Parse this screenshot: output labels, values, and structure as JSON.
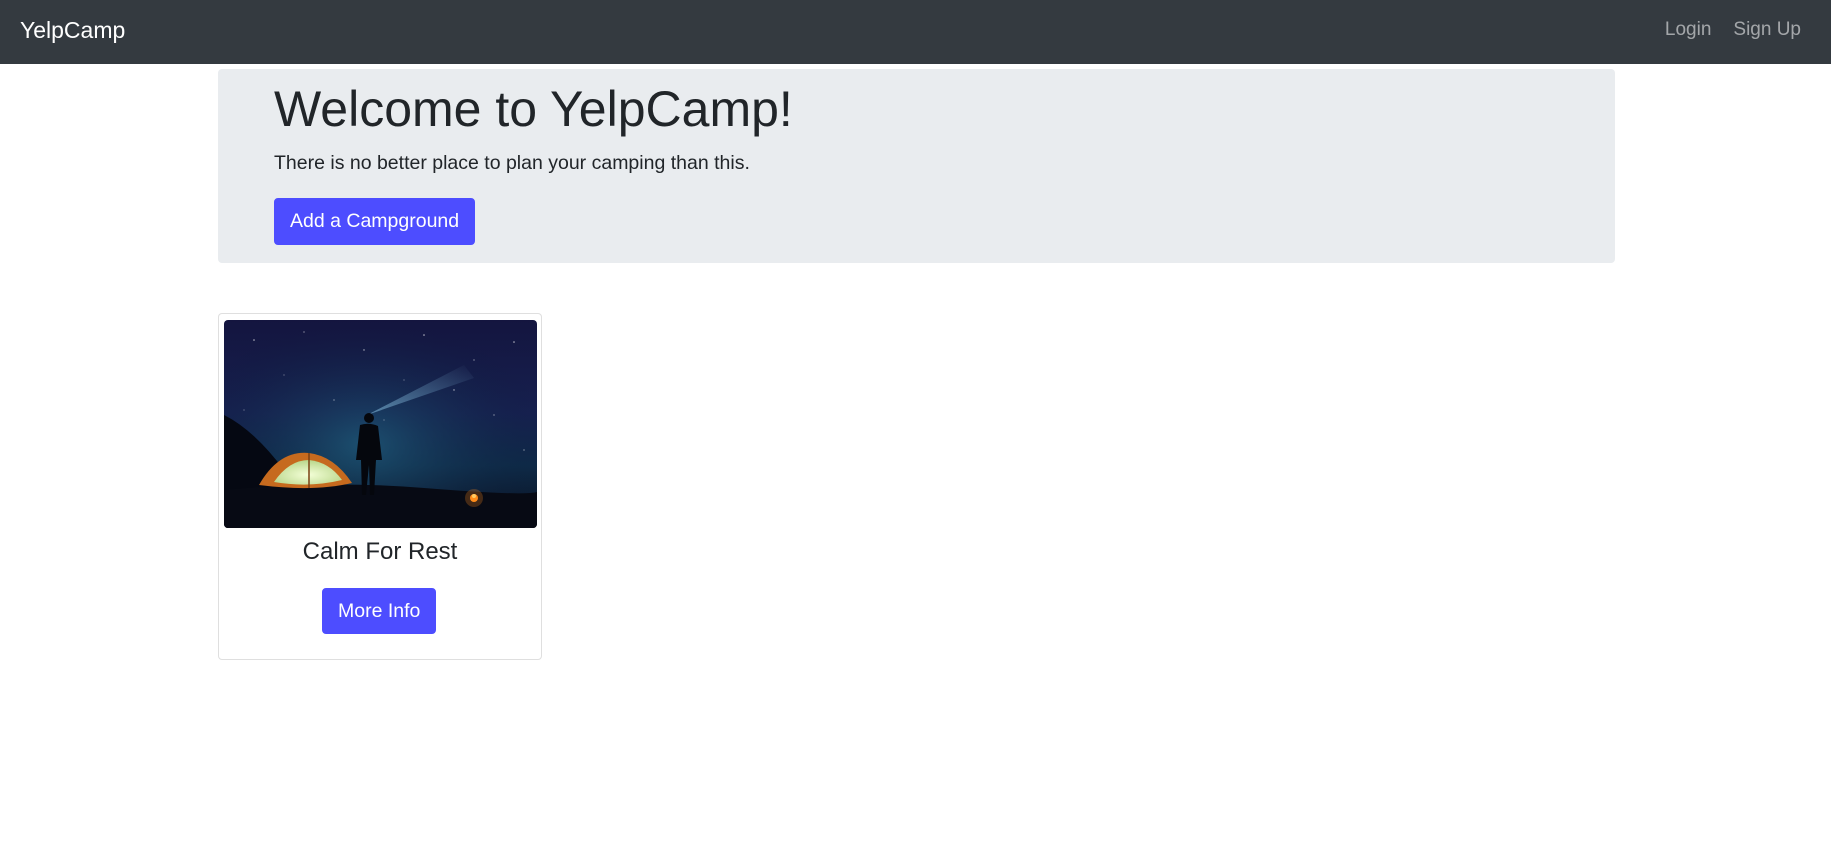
{
  "navbar": {
    "brand": "YelpCamp",
    "links": {
      "login": "Login",
      "signup": "Sign Up"
    }
  },
  "jumbotron": {
    "title": "Welcome to YelpCamp!",
    "lead": "There is no better place to plan your camping than this.",
    "button_label": "Add a Campground"
  },
  "campgrounds": [
    {
      "name": "Calm For Rest",
      "button_label": "More Info",
      "image_icon": "night-camping-photo"
    }
  ],
  "colors": {
    "navbar_bg": "#343a40",
    "jumbotron_bg": "#e9ecef",
    "accent": "#4d4dff"
  }
}
